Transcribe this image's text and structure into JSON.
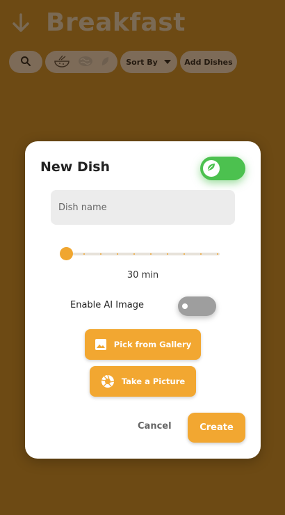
{
  "screen": {
    "title": "Breakfast",
    "back_icon": "arrow-down-icon",
    "toolbar": {
      "search_icon": "search-icon",
      "filter_icons": [
        "dish-bowl-icon",
        "brain-icon",
        "leaf-icon"
      ],
      "sort_label": "Sort By",
      "add_label": "Add Dishes"
    }
  },
  "dialog": {
    "title": "New Dish",
    "veg_toggle_on": true,
    "name_placeholder": "Dish name",
    "time_slider": {
      "value_label": "30 min",
      "position": 0
    },
    "ai_image": {
      "label": "Enable AI Image",
      "enabled": false
    },
    "gallery_button": "Pick from Gallery",
    "camera_button": "Take a Picture",
    "cancel_label": "Cancel",
    "create_label": "Create"
  },
  "colors": {
    "accent": "#f2a731",
    "toggle_on": "#4cc14f",
    "toggle_off": "#9e9e9e",
    "overlay_bg": "#6d4a14"
  }
}
